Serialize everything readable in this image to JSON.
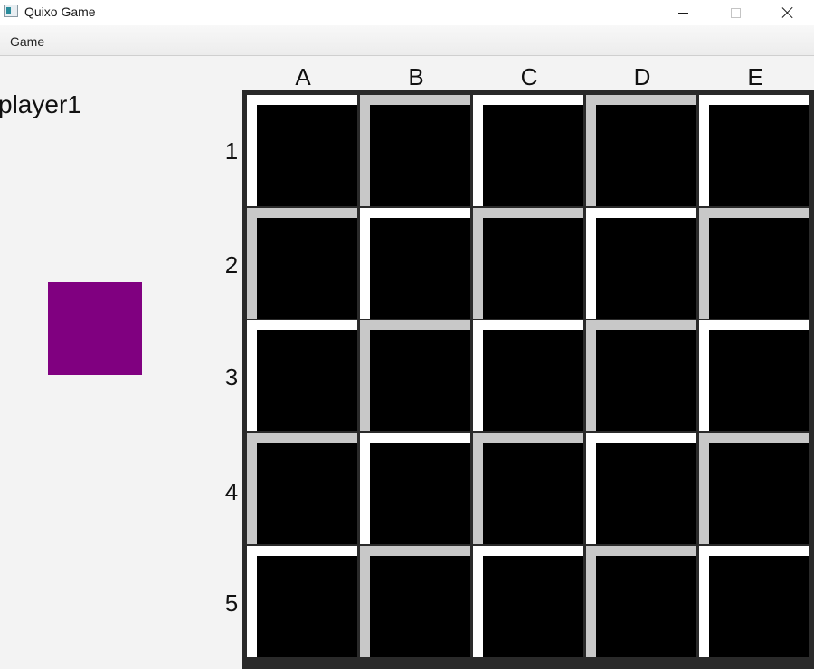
{
  "window": {
    "title": "Quixo Game"
  },
  "menu": {
    "items": [
      "Game"
    ]
  },
  "player": {
    "name": "player1",
    "color": "#800080"
  },
  "board": {
    "columns": [
      "A",
      "B",
      "C",
      "D",
      "E"
    ],
    "rows": [
      "1",
      "2",
      "3",
      "4",
      "5"
    ],
    "cell_fill": "#000000",
    "frame_colors": {
      "light": "#ffffff",
      "gray": "#c8c8c8"
    },
    "frames": [
      [
        "light",
        "gray",
        "light",
        "gray",
        "light"
      ],
      [
        "gray",
        "light",
        "gray",
        "light",
        "gray"
      ],
      [
        "light",
        "gray",
        "light",
        "gray",
        "light"
      ],
      [
        "gray",
        "light",
        "gray",
        "light",
        "gray"
      ],
      [
        "light",
        "gray",
        "light",
        "gray",
        "light"
      ]
    ]
  }
}
